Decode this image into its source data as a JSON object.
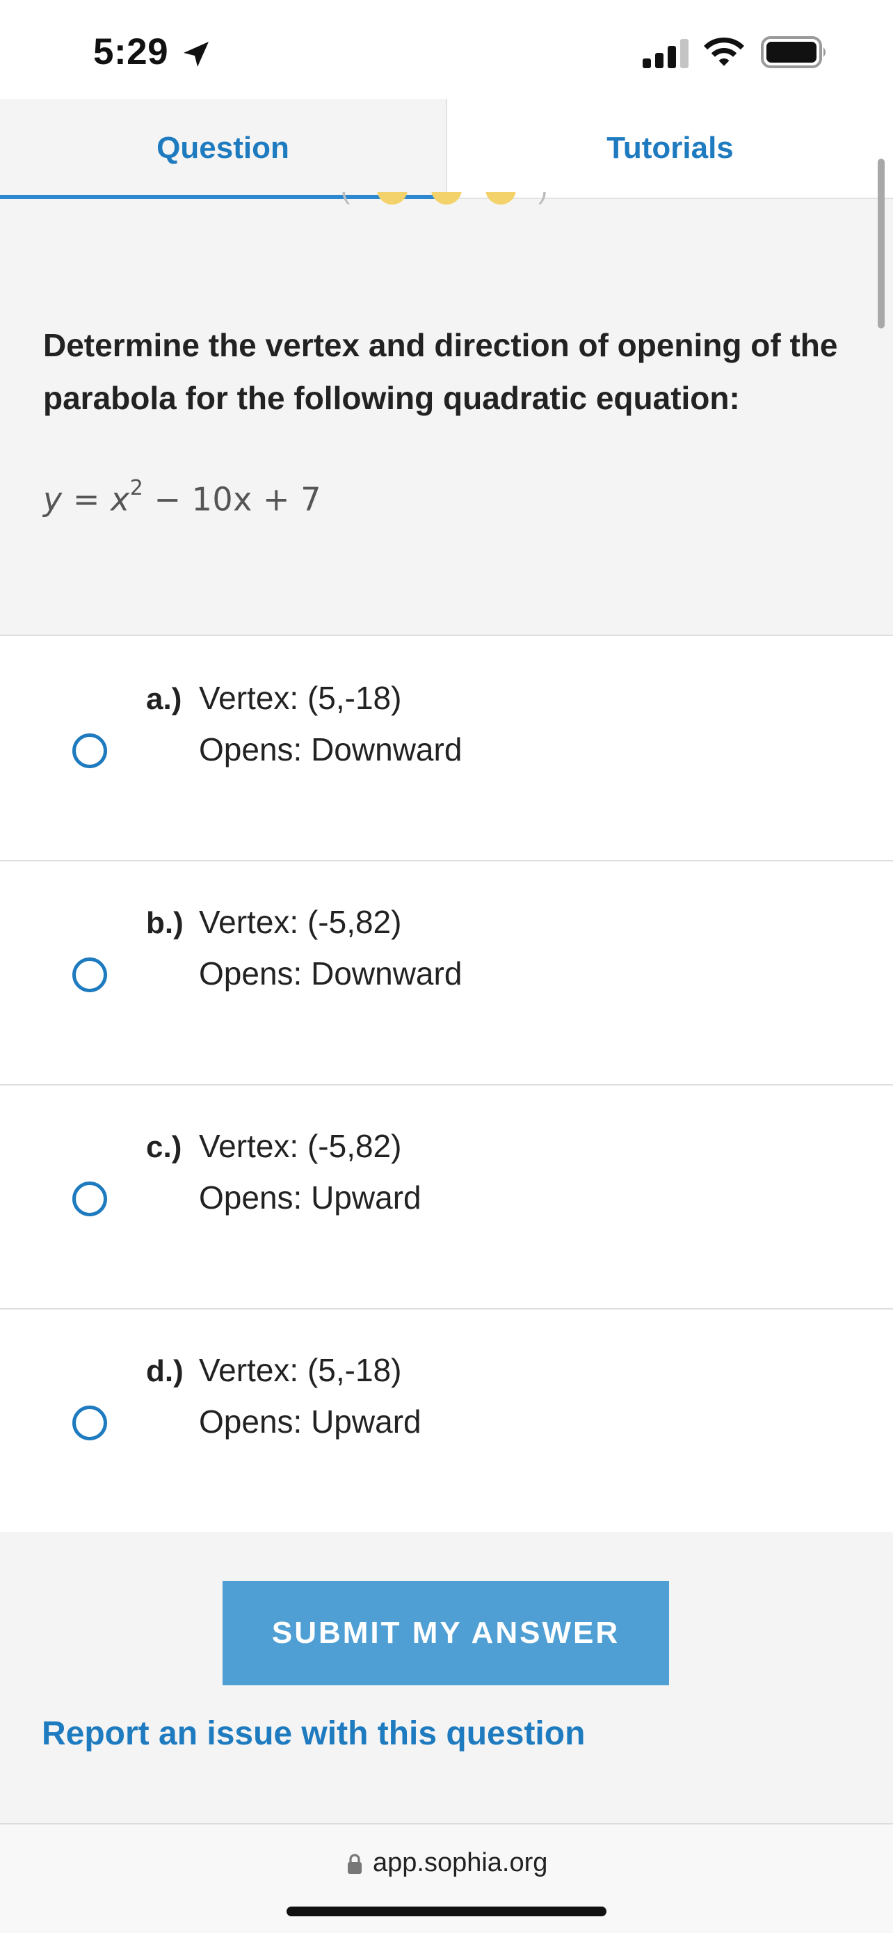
{
  "status_bar": {
    "time": "5:29",
    "icons": [
      "location-arrow-icon",
      "cellular-signal-icon",
      "wifi-icon",
      "battery-icon"
    ]
  },
  "tabs": [
    {
      "label": "Question",
      "active": true
    },
    {
      "label": "Tutorials",
      "active": false
    }
  ],
  "question": {
    "prompt": "Determine the vertex and direction of opening of the parabola for the following quadratic equation:",
    "equation": {
      "lhs": "y",
      "equals": " = ",
      "x": "x",
      "exponent": "2",
      "rest": " − 10x + 7"
    }
  },
  "options": [
    {
      "letter": "a.)",
      "vertex": "Vertex: (5,-18)",
      "opens": "Opens: Downward",
      "selected": false
    },
    {
      "letter": "b.)",
      "vertex": "Vertex: (-5,82)",
      "opens": "Opens: Downward",
      "selected": false
    },
    {
      "letter": "c.)",
      "vertex": "Vertex: (-5,82)",
      "opens": "Opens: Upward",
      "selected": false
    },
    {
      "letter": "d.)",
      "vertex": "Vertex: (5,-18)",
      "opens": "Opens: Upward",
      "selected": false
    }
  ],
  "actions": {
    "submit_label": "SUBMIT MY ANSWER",
    "report_label": "Report an issue with this question"
  },
  "browser": {
    "url": "app.sophia.org"
  },
  "colors": {
    "accent": "#1f7bbf",
    "submit_bg": "#4f9fd4",
    "panel_bg": "#f4f4f4"
  }
}
